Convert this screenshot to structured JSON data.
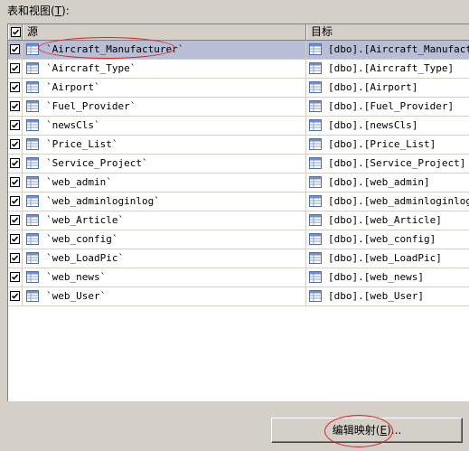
{
  "section": {
    "label_prefix": "表和视图(",
    "label_mnemonic": "T",
    "label_suffix": "):"
  },
  "list": {
    "columns": {
      "check_checked": true,
      "source": "源",
      "target": "目标"
    },
    "rows": [
      {
        "checked": true,
        "source": "`Aircraft_Manufacturer`",
        "target": "[dbo].[Aircraft_Manufactur",
        "selected": true
      },
      {
        "checked": true,
        "source": "`Aircraft_Type`",
        "target": "[dbo].[Aircraft_Type]",
        "selected": false
      },
      {
        "checked": true,
        "source": "`Airport`",
        "target": "[dbo].[Airport]",
        "selected": false
      },
      {
        "checked": true,
        "source": "`Fuel_Provider`",
        "target": "[dbo].[Fuel_Provider]",
        "selected": false
      },
      {
        "checked": true,
        "source": "`newsCls`",
        "target": "[dbo].[newsCls]",
        "selected": false
      },
      {
        "checked": true,
        "source": "`Price_List`",
        "target": "[dbo].[Price_List]",
        "selected": false
      },
      {
        "checked": true,
        "source": "`Service_Project`",
        "target": "[dbo].[Service_Project]",
        "selected": false
      },
      {
        "checked": true,
        "source": "`web_admin`",
        "target": "[dbo].[web_admin]",
        "selected": false
      },
      {
        "checked": true,
        "source": "`web_adminloginlog`",
        "target": "[dbo].[web_adminloginlog]",
        "selected": false
      },
      {
        "checked": true,
        "source": "`web_Article`",
        "target": "[dbo].[web_Article]",
        "selected": false
      },
      {
        "checked": true,
        "source": "`web_config`",
        "target": "[dbo].[web_config]",
        "selected": false
      },
      {
        "checked": true,
        "source": "`web_LoadPic`",
        "target": "[dbo].[web_LoadPic]",
        "selected": false
      },
      {
        "checked": true,
        "source": "`web_news`",
        "target": "[dbo].[web_news]",
        "selected": false
      },
      {
        "checked": true,
        "source": "`web_User`",
        "target": "[dbo].[web_User]",
        "selected": false
      }
    ],
    "icons": {
      "row_source": "table-icon",
      "row_target": "table-icon",
      "check": "checkmark-icon"
    }
  },
  "button": {
    "label_prefix": "编辑映射(",
    "label_mnemonic": "E",
    "label_suffix": ")..."
  },
  "colors": {
    "window_bg": "#d4d0c8",
    "selection_bg": "#b7bed6",
    "highlight_annotation": "#e02020"
  }
}
